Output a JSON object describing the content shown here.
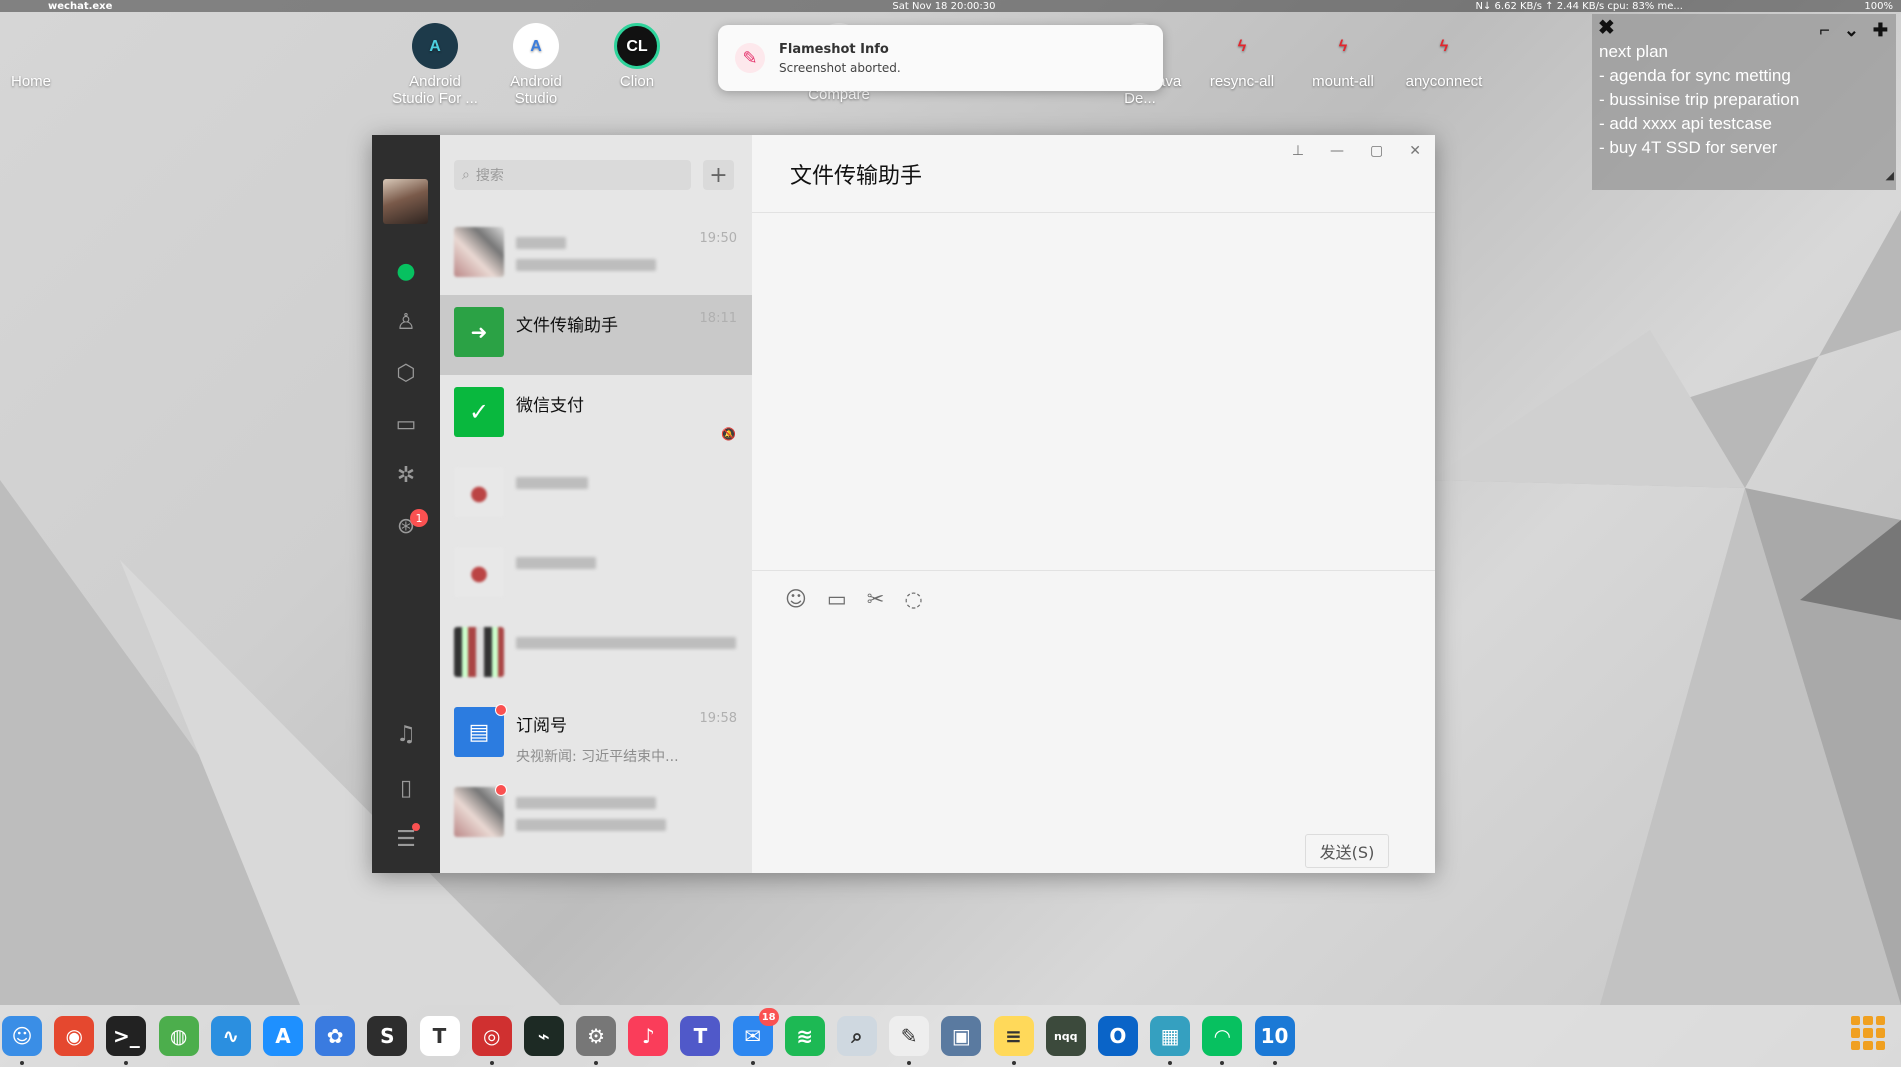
{
  "menubar": {
    "app_name": "wechat.exe",
    "clock": "Sat Nov 18  20:00:30",
    "net": "N↓  6.62 KB/s ↑  2.44 KB/s cpu: 83% me...",
    "battery": "100%"
  },
  "desktop_icons": [
    {
      "label": "Home",
      "icon": "apple-icon",
      "glyph": ""
    },
    {
      "label": "Android Studio For ...",
      "icon": "android-studio-icon",
      "glyph": "A"
    },
    {
      "label": "Android Studio",
      "icon": "android-studio-icon",
      "glyph": "A"
    },
    {
      "label": "Clion",
      "icon": "clion-icon",
      "glyph": "CL"
    },
    {
      "label": "Compare",
      "icon": "compare-icon",
      "glyph": ""
    },
    {
      "label": "IDE for Java De...",
      "icon": "eclipse-icon",
      "glyph": ""
    },
    {
      "label": "resync-all",
      "icon": "bolt-icon",
      "glyph": "ϟ"
    },
    {
      "label": "mount-all",
      "icon": "bolt-icon",
      "glyph": "ϟ"
    },
    {
      "label": "anyconnect",
      "icon": "bolt-icon",
      "glyph": "ϟ"
    }
  ],
  "notification": {
    "title": "Flameshot Info",
    "body": "Screenshot aborted."
  },
  "sticky": {
    "lines": [
      "next plan",
      "- agenda for sync metting",
      "- bussinise trip preparation",
      "- add xxxx api testcase",
      "- buy 4T SSD for server"
    ]
  },
  "wechat": {
    "search_placeholder": "搜索",
    "rail_badge": "1",
    "chat_title": "文件传输助手",
    "send_label": "发送(S)",
    "chats": [
      {
        "name": "",
        "msg": "",
        "time": "19:50",
        "blurred": true,
        "avatar": "photo"
      },
      {
        "name": "文件传输助手",
        "msg": "",
        "time": "18:11",
        "selected": true,
        "avatar": "filetransfer"
      },
      {
        "name": "微信支付",
        "msg": "",
        "time": "",
        "muted": true,
        "avatar": "wxpay"
      },
      {
        "name": "",
        "msg": "",
        "time": "",
        "blurred": true,
        "avatar": "pink"
      },
      {
        "name": "",
        "msg": "",
        "time": "",
        "blurred": true,
        "avatar": "pink"
      },
      {
        "name": "",
        "msg": "",
        "time": "",
        "blurred": true,
        "avatar": "mosaic"
      },
      {
        "name": "订阅号",
        "msg": "央视新闻: 习近平结束中...",
        "time": "19:58",
        "avatar": "subscription",
        "dot": true
      },
      {
        "name": "",
        "msg": "",
        "time": "",
        "blurred": true,
        "avatar": "photo",
        "dot": true
      }
    ]
  },
  "dock": {
    "mail_badge": "18",
    "items": [
      {
        "icon": "finder-icon",
        "color": "#3a8ee6",
        "glyph": "☺"
      },
      {
        "icon": "chrome-icon",
        "color": "#e5482f",
        "glyph": "◉"
      },
      {
        "icon": "terminal-icon",
        "color": "#222",
        "glyph": ">_"
      },
      {
        "icon": "network-icon",
        "color": "#4cae4c",
        "glyph": "◍"
      },
      {
        "icon": "activity-icon",
        "color": "#2b8fe0",
        "glyph": "∿"
      },
      {
        "icon": "appstore-icon",
        "color": "#1e90ff",
        "glyph": "A"
      },
      {
        "icon": "photo-icon",
        "color": "#3a7be0",
        "glyph": "✿"
      },
      {
        "icon": "sublime-icon",
        "color": "#2d2d2d",
        "glyph": "S"
      },
      {
        "icon": "typora-icon",
        "color": "#fff",
        "glyph": "T"
      },
      {
        "icon": "disk-icon",
        "color": "#d03030",
        "glyph": "◎"
      },
      {
        "icon": "monitor-icon",
        "color": "#1d2a24",
        "glyph": "⌁"
      },
      {
        "icon": "settings-icon",
        "color": "#777",
        "glyph": "⚙"
      },
      {
        "icon": "music-icon",
        "color": "#fa3d5a",
        "glyph": "♪"
      },
      {
        "icon": "teams-icon",
        "color": "#5059c9",
        "glyph": "T"
      },
      {
        "icon": "mail-icon",
        "color": "#2d87f0",
        "glyph": "✉"
      },
      {
        "icon": "spotify-icon",
        "color": "#1db954",
        "glyph": "≋"
      },
      {
        "icon": "preview-icon",
        "color": "#cfd8e0",
        "glyph": "⌕"
      },
      {
        "icon": "notes-paper-icon",
        "color": "#eeeeee",
        "glyph": "✎"
      },
      {
        "icon": "screenshot-icon",
        "color": "#5a7aa0",
        "glyph": "▣"
      },
      {
        "icon": "notes-icon",
        "color": "#ffd95a",
        "glyph": "≡"
      },
      {
        "icon": "notebook-icon",
        "color": "#3c4a3c",
        "glyph": "nqq"
      },
      {
        "icon": "outlook-icon",
        "color": "#0a64c8",
        "glyph": "O"
      },
      {
        "icon": "remote-desktop-icon",
        "color": "#35a0c0",
        "glyph": "▦"
      },
      {
        "icon": "wechat-icon",
        "color": "#07c160",
        "glyph": "◠"
      },
      {
        "icon": "windows-10-icon",
        "color": "#1b79d6",
        "glyph": "10"
      }
    ]
  }
}
